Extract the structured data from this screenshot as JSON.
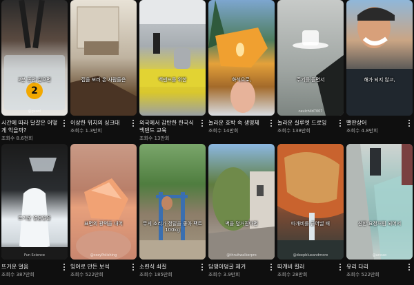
{
  "shorts": [
    {
      "title": "시간에 따라 달걀은 어떻게 익을까?",
      "views": "조회수 8.6천회",
      "overlay": "2분 동안 삶으면",
      "badge": "2",
      "watermark": "@geonl"
    },
    {
      "title": "이상한 위치의 싱크대",
      "views": "조회수 1.3만회",
      "overlay": "집을 보러 온 사람들은"
    },
    {
      "title": "외국에서 감탄한 한국식 백덴드 교육",
      "views": "조회수 13만회",
      "overlay": "백덴드를 위한"
    },
    {
      "title": "놀라운 호박 속 생명체",
      "views": "조회수 14만회",
      "overlay": "화석으로,"
    },
    {
      "title": "놀라운 실루엣 드로잉",
      "views": "조회수 138만회",
      "overlay": "주기를 돌면서",
      "watermark": "caulchild7007"
    },
    {
      "title": "빨판상어",
      "views": "조회수 4.8만회",
      "overlay": "해가 되지 않고,"
    },
    {
      "title": "뜨거운 얼음",
      "views": "조회수 387만회",
      "overlay": "뜨거운 얼음일을",
      "watermark": "Fun Science"
    },
    {
      "title": "잉어로 만든 보석",
      "views": "조회수 522만회",
      "overlay": "표면의 광택을 내어",
      "watermark": "@cozyPolishing"
    },
    {
      "title": "소련식 쇠질",
      "views": "조회수 185만회",
      "overlay": "무게 소리가 정말을 좋아 팩트 100kg"
    },
    {
      "title": "담쟁이덩굴 제거",
      "views": "조회수 3.9만회",
      "overlay": "벽을 덮거진다면",
      "watermark": "@thruitwalkerpro"
    },
    {
      "title": "따개비 킬러",
      "views": "조회수 28만회",
      "overlay": "따개비를 긁어낼 때",
      "watermark": "@deepblueandmore"
    },
    {
      "title": "유리 다리",
      "views": "조회수 522만회",
      "overlay": "신한 요정처럼 되어서",
      "watermark": "@anoao"
    }
  ]
}
